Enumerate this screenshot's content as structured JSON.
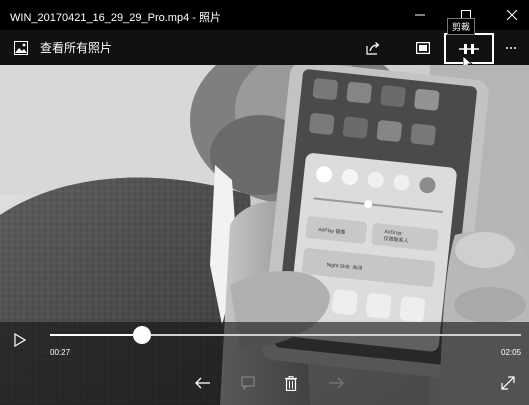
{
  "window": {
    "title": "WIN_20170421_16_29_29_Pro.mp4 - 照片"
  },
  "titlebar_buttons": [
    {
      "icon": "minimize-icon"
    },
    {
      "icon": "maximize-icon"
    },
    {
      "icon": "close-icon"
    }
  ],
  "toolbar": {
    "back_label": "查看所有照片",
    "back_icon": "photos-icon",
    "share_icon": "share-icon",
    "slideshow_icon": "slideshow-icon",
    "trim_icon": "trim-icon",
    "more_icon": "more-icon",
    "tooltip": "剪裁"
  },
  "player": {
    "current_time": "00:27",
    "total_time": "02:05",
    "progress": 0.196,
    "play_icon": "play-icon"
  },
  "bottom_bar": [
    {
      "icon": "arrow-left-icon",
      "enabled": true
    },
    {
      "icon": "annotate-icon",
      "enabled": false
    },
    {
      "icon": "delete-icon",
      "enabled": true
    },
    {
      "icon": "arrow-right-icon",
      "enabled": false
    },
    {
      "icon": "fullscreen-icon",
      "enabled": true
    }
  ],
  "phone_screen": {
    "airplay_label": "AirPlay 镜像",
    "airdrop_label": "AirDrop:",
    "airdrop_sub": "仅限联系人",
    "night_shift_label": "Night Shift: 关闭"
  }
}
